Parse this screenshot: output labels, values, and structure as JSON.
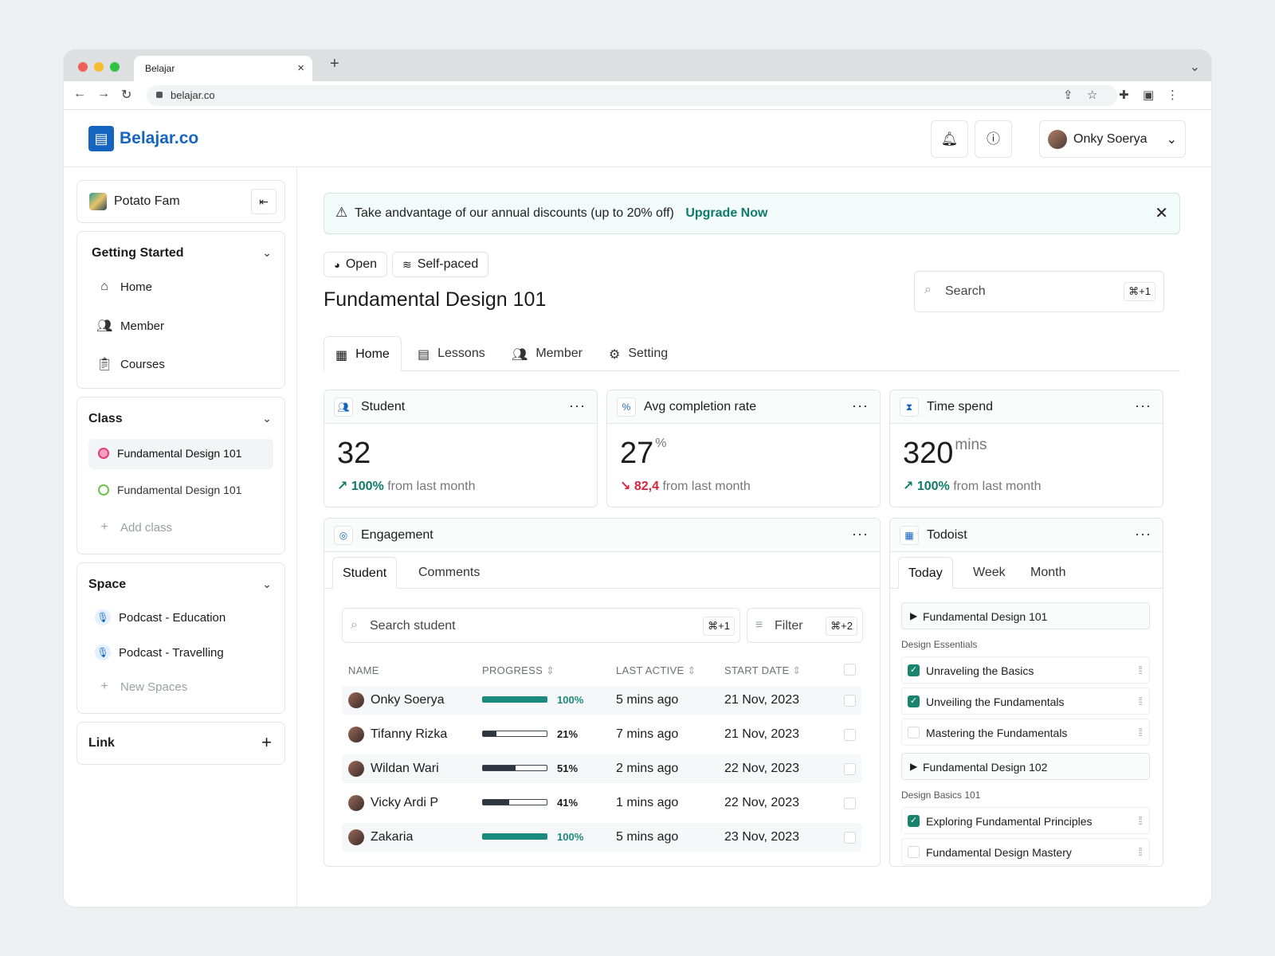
{
  "browser": {
    "tab_title": "Belajar",
    "tab_close": "×",
    "new_tab": "+",
    "url": "belajar.co"
  },
  "header": {
    "brand": "Belajar.co",
    "user_name": "Onky Soerya"
  },
  "sidebar": {
    "org_name": "Potato Fam",
    "getting_started": {
      "title": "Getting Started",
      "items": [
        {
          "label": "Home",
          "icon": "home-icon"
        },
        {
          "label": "Member",
          "icon": "users-icon"
        },
        {
          "label": "Courses",
          "icon": "clipboard-icon"
        }
      ]
    },
    "class": {
      "title": "Class",
      "items": [
        {
          "label": "Fundamental Design 101",
          "color": "#e5397a"
        },
        {
          "label": "Fundamental Design 101",
          "color": "#6cc24a"
        }
      ],
      "add_label": "Add class"
    },
    "space": {
      "title": "Space",
      "items": [
        {
          "label": "Podcast - Education",
          "icon": "mic-icon"
        },
        {
          "label": "Podcast - Travelling",
          "icon": "mic-icon"
        }
      ],
      "add_label": "New Spaces"
    },
    "link": {
      "title": "Link"
    }
  },
  "banner": {
    "text": "Take andvantage of our annual discounts (up to 20% off)",
    "link": "Upgrade Now"
  },
  "course": {
    "status": "Open",
    "mode": "Self-paced",
    "title": "Fundamental Design 101",
    "search_placeholder": "Search",
    "search_shortcut": "⌘+1",
    "tabs": [
      "Home",
      "Lessons",
      "Member",
      "Setting"
    ]
  },
  "stats": [
    {
      "title": "Student",
      "value": "32",
      "unit": "",
      "change": "100%",
      "change_suffix": "from last month",
      "direction": "up"
    },
    {
      "title": "Avg completion rate",
      "value": "27",
      "unit": "%",
      "change": "82,4",
      "change_suffix": "from last month",
      "direction": "down"
    },
    {
      "title": "Time spend",
      "value": "320",
      "unit": "mins",
      "change": "100%",
      "change_suffix": "from last month",
      "direction": "up"
    }
  ],
  "engagement": {
    "title": "Engagement",
    "tabs": [
      "Student",
      "Comments"
    ],
    "search_placeholder": "Search student",
    "search_shortcut": "⌘+1",
    "filter_label": "Filter",
    "filter_shortcut": "⌘+2",
    "columns": [
      "NAME",
      "PROGRESS",
      "LAST ACTIVE",
      "START DATE"
    ],
    "rows": [
      {
        "name": "Onky Soerya",
        "progress": 100,
        "progress_label": "100%",
        "last_active": "5 mins ago",
        "start_date": "21 Nov, 2023"
      },
      {
        "name": "Tifanny Rizka",
        "progress": 21,
        "progress_label": "21%",
        "last_active": "7 mins ago",
        "start_date": "21 Nov, 2023"
      },
      {
        "name": "Wildan Wari",
        "progress": 51,
        "progress_label": "51%",
        "last_active": "2 mins ago",
        "start_date": "22 Nov, 2023"
      },
      {
        "name": "Vicky Ardi P",
        "progress": 41,
        "progress_label": "41%",
        "last_active": "1 mins ago",
        "start_date": "22 Nov, 2023"
      },
      {
        "name": "Zakaria",
        "progress": 100,
        "progress_label": "100%",
        "last_active": "5 mins ago",
        "start_date": "23 Nov, 2023"
      }
    ]
  },
  "todoist": {
    "title": "Todoist",
    "tabs": [
      "Today",
      "Week",
      "Month"
    ],
    "groups": [
      {
        "title": "Fundamental Design 101",
        "section": "Design Essentials",
        "tasks": [
          {
            "label": "Unraveling the Basics",
            "done": true
          },
          {
            "label": "Unveiling the Fundamentals",
            "done": true
          },
          {
            "label": "Mastering the Fundamentals",
            "done": false
          }
        ]
      },
      {
        "title": "Fundamental Design 102",
        "section": "Design Basics 101",
        "tasks": [
          {
            "label": "Exploring Fundamental Principles",
            "done": true
          },
          {
            "label": "Fundamental Design Mastery",
            "done": false
          }
        ]
      }
    ]
  },
  "colors": {
    "brand": "#1565c0",
    "accent_green": "#0f7a6a",
    "negative": "#d6243d"
  }
}
